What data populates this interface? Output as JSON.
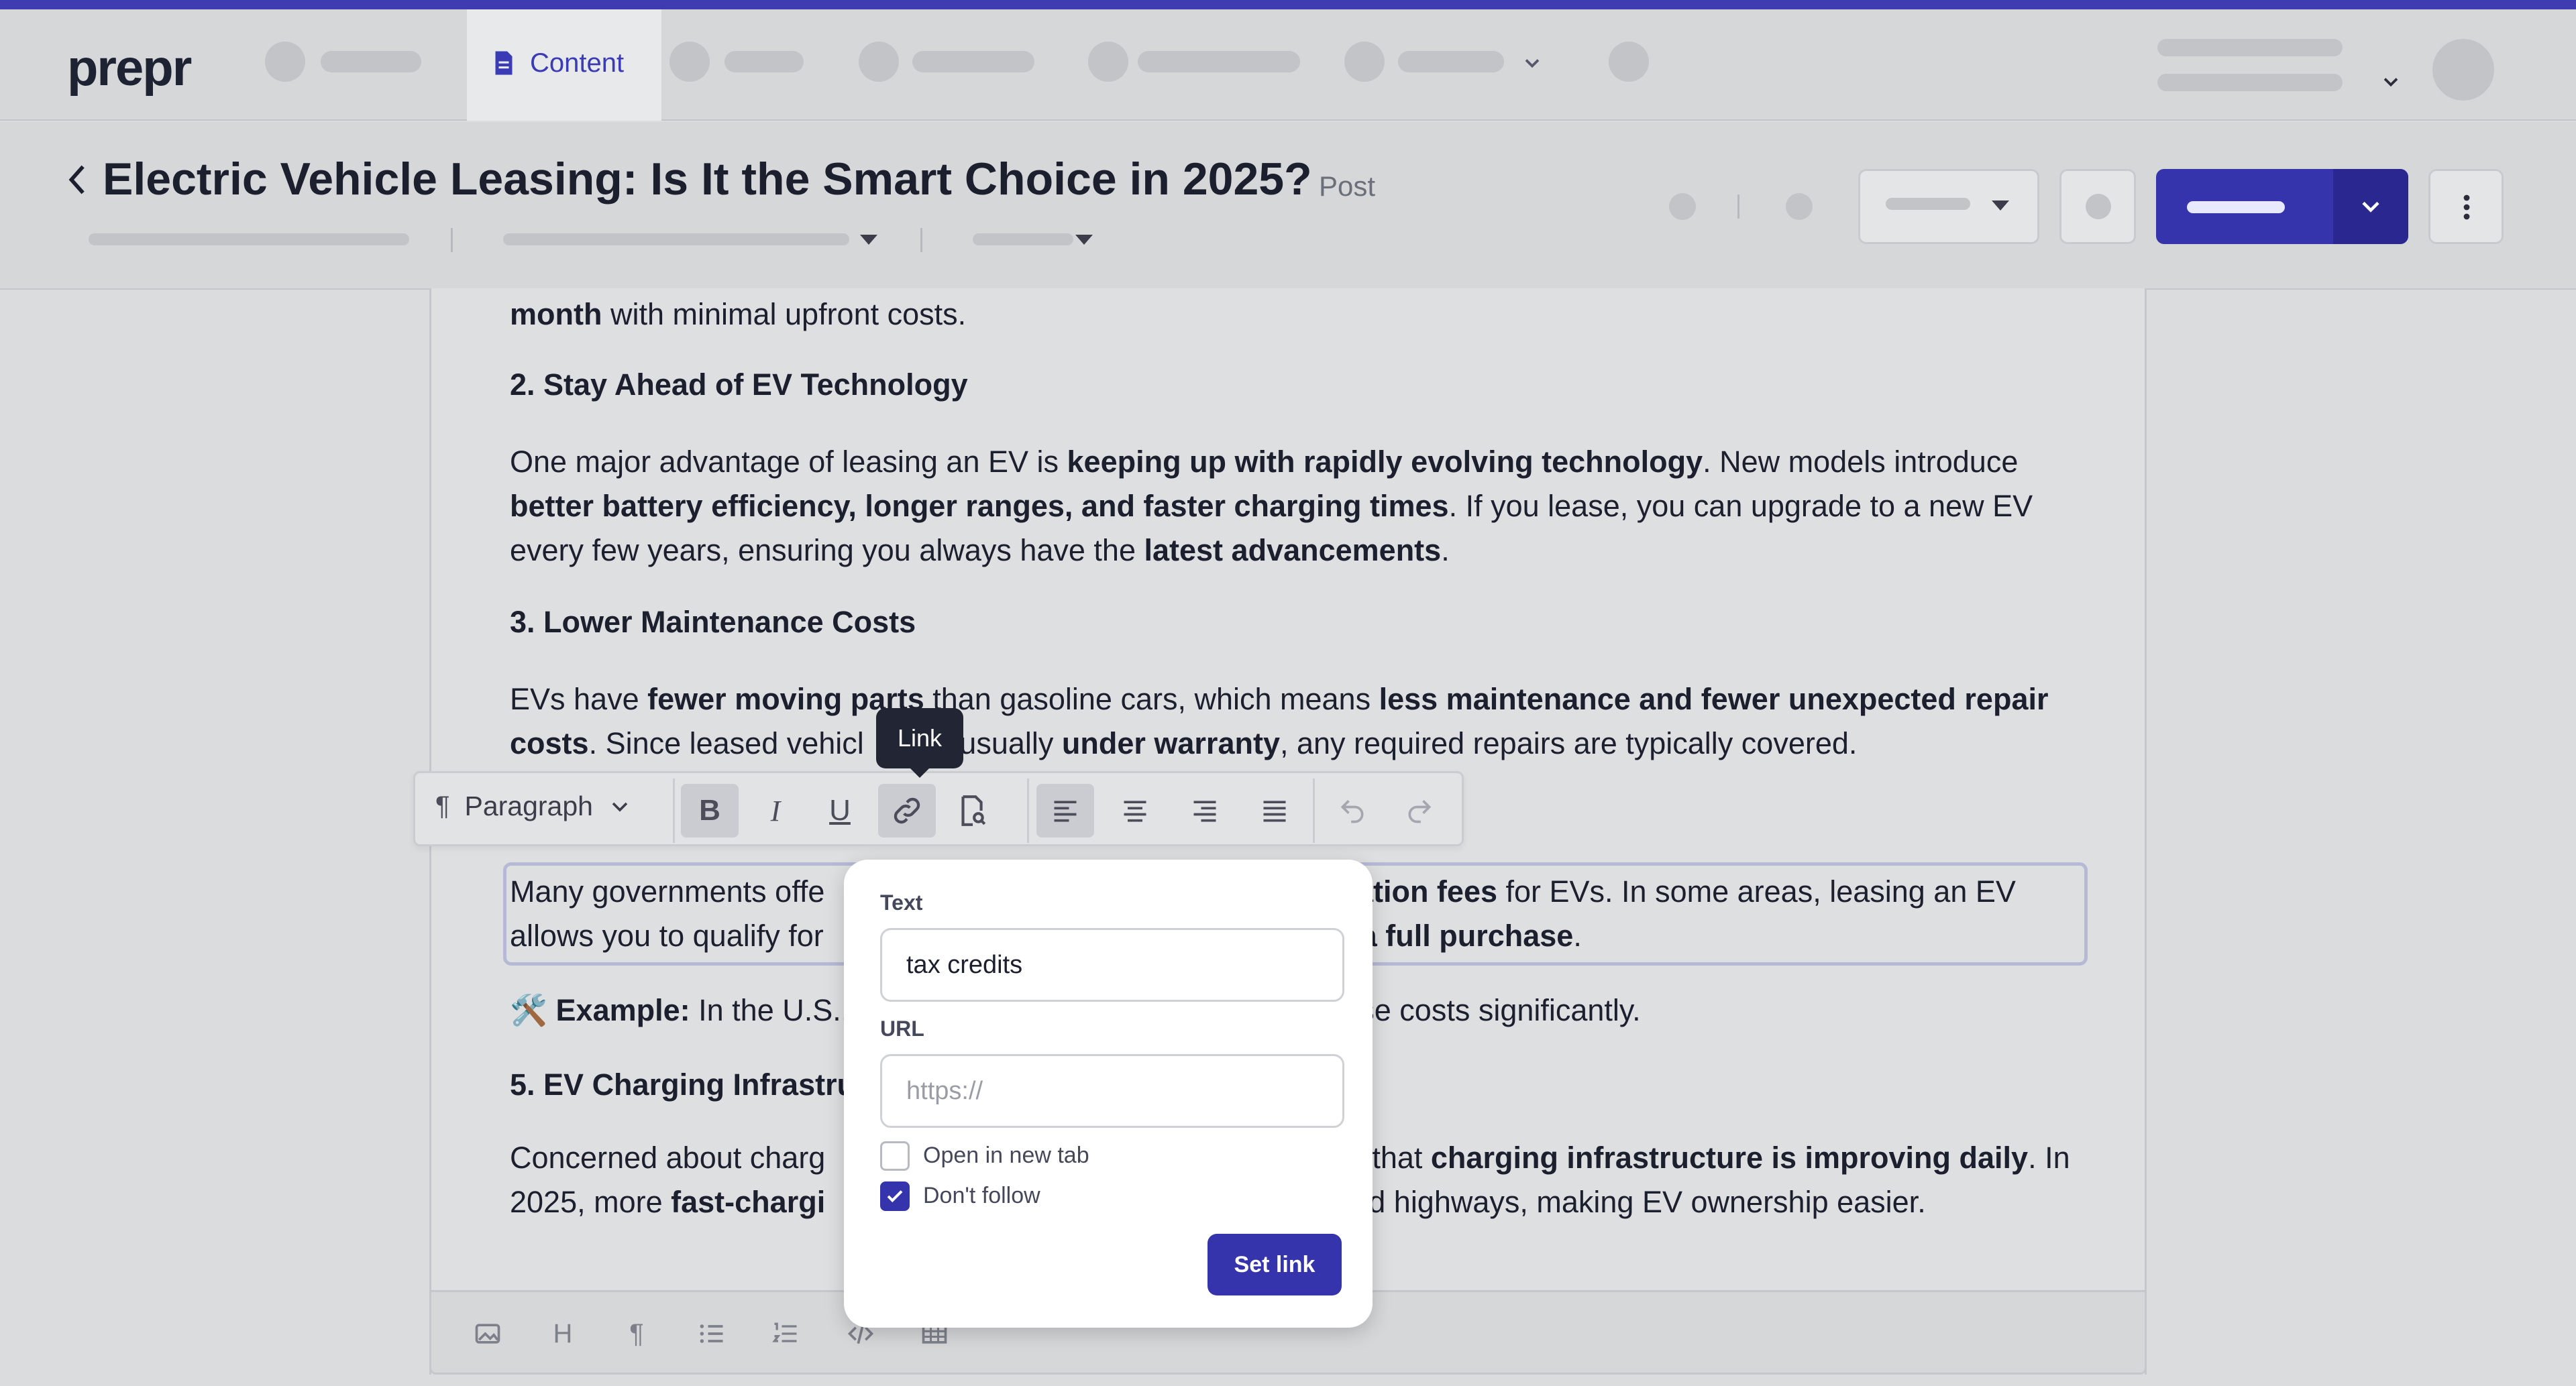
{
  "app": {
    "logo": "prepr"
  },
  "nav": {
    "active_tab": "Content"
  },
  "header": {
    "back": "back",
    "title": "Electric Vehicle Leasing: Is It the Smart Choice in 2025?",
    "type": "Post"
  },
  "article": {
    "p0": {
      "b1": "month",
      "t1": " with minimal upfront costs."
    },
    "h2": "2. Stay Ahead of EV Technology",
    "p1": {
      "l1_t1": "One major advantage of leasing an EV is ",
      "l1_b1": "keeping up with rapidly evolving technology",
      "l1_t2": ". New models introduce",
      "l2_b1": "better battery efficiency, longer ranges, and faster charging times",
      "l2_t1": ". If you lease, you can upgrade to a new EV",
      "l3_t1": "every few years, ensuring you always have the ",
      "l3_b1": "latest advancements",
      "l3_t2": "."
    },
    "h3": "3. Lower Maintenance Costs",
    "p2": {
      "l1_t1": "EVs have ",
      "l1_b1": "fewer moving parts",
      "l1_t2": " than gasoline cars, which means ",
      "l1_b2": "less maintenance and fewer unexpected repair",
      "l2_b1": "costs",
      "l2_t1": ". Since leased vehicl",
      "l2_t2": " usually ",
      "l2_b2": "under warranty",
      "l2_t3": ", any required repairs are typically covered."
    },
    "p3": {
      "l1_t1": "Many governments offe",
      "l1_b1": "tration fees",
      "l1_t2": " for EVs. In some areas, leasing an EV",
      "l2_t1": "allows you to qualify for",
      "l2_b1": "a full purchase",
      "l2_t2": "."
    },
    "p4": {
      "emoji": "🛠️ ",
      "b1": "Example:",
      "t1": " In the U.S.,",
      "t2": "se costs significantly."
    },
    "h5": "5. EV Charging Infrastru",
    "p5": {
      "l1_t1": "Concerned about charg",
      "l1_t2": "s that ",
      "l1_b1": "charging infrastructure is improving daily",
      "l1_t3": ". In",
      "l2_t1": "2025, more ",
      "l2_b1": "fast-chargi",
      "l2_t2": "and highways, making EV ownership easier."
    }
  },
  "toolbar": {
    "block_type": "Paragraph",
    "tooltip": "Link",
    "bold": "B",
    "italic": "I",
    "underline": "U"
  },
  "link_popover": {
    "text_label": "Text",
    "text_value": "tax credits",
    "url_label": "URL",
    "url_placeholder": "https://",
    "open_new_tab_label": "Open in new tab",
    "open_new_tab_checked": false,
    "dont_follow_label": "Don't follow",
    "dont_follow_checked": true,
    "submit_label": "Set link"
  },
  "colors": {
    "accent": "#3634ad",
    "top_stripe": "#3f3bb0"
  }
}
